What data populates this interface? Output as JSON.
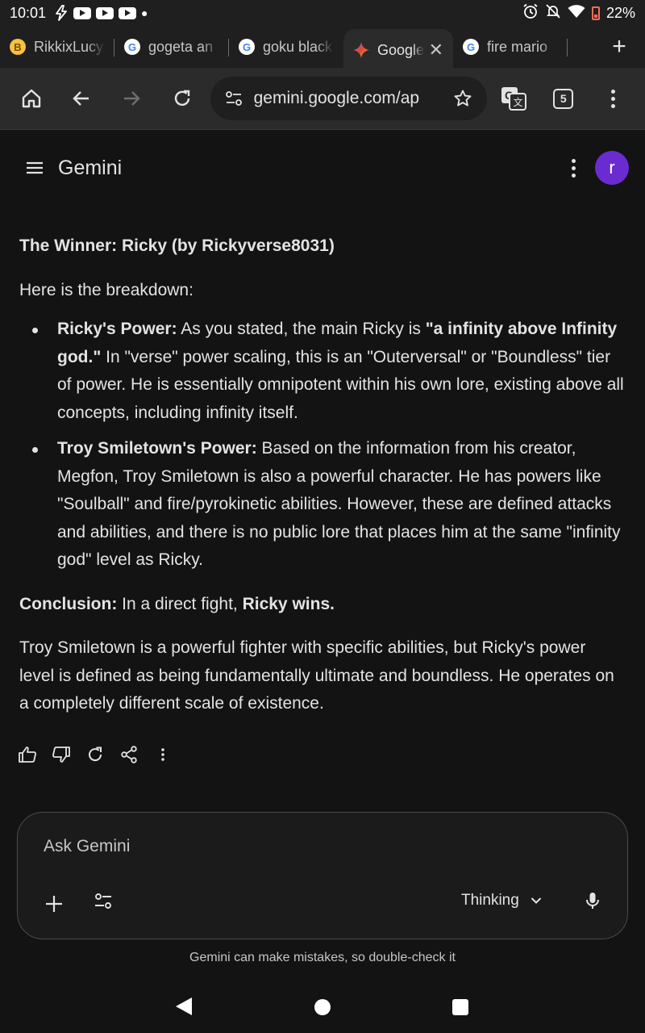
{
  "status_bar": {
    "time": "10:01",
    "battery": "22%"
  },
  "tabs": [
    {
      "label": "RikkixLucy",
      "favicon": "b-favicon"
    },
    {
      "label": "gogeta an",
      "favicon": "google-favicon"
    },
    {
      "label": "goku black",
      "favicon": "google-favicon"
    },
    {
      "label": "Google",
      "favicon": "gemini-favicon",
      "active": true
    },
    {
      "label": "fire mario",
      "favicon": "google-favicon"
    }
  ],
  "toolbar": {
    "url": "gemini.google.com/ap",
    "tab_count": "5"
  },
  "app": {
    "title": "Gemini",
    "avatar_letter": "r"
  },
  "response": {
    "winner": "The Winner: Ricky (by Rickyverse8031)",
    "intro": "Here is the breakdown:",
    "bullet1_head": "Ricky's Power:",
    "bullet1_text1": " As you stated, the main Ricky is ",
    "bullet1_quote": "\"a infinity above Infinity god.\"",
    "bullet1_text2": " In \"verse\" power scaling, this is an \"Outerversal\" or \"Boundless\" tier of power. He is essentially omnipotent within his own lore, existing above all concepts, including infinity itself.",
    "bullet2_head": "Troy Smiletown's Power:",
    "bullet2_text": " Based on the information from his creator, Megfon, Troy Smiletown is also a powerful character. He has powers like \"Soulball\" and fire/pyrokinetic abilities. However, these are defined attacks and abilities, and there is no public lore that places him at the same \"infinity god\" level as Ricky.",
    "conclusion_head": "Conclusion:",
    "conclusion_text": " In a direct fight, ",
    "conclusion_bold": "Ricky wins.",
    "summary": "Troy Smiletown is a powerful fighter with specific abilities, but Ricky's power level is defined as being fundamentally ultimate and boundless. He operates on a completely different scale of existence."
  },
  "input": {
    "placeholder": "Ask Gemini",
    "mode": "Thinking"
  },
  "disclaimer": "Gemini can make mistakes, so double-check it"
}
